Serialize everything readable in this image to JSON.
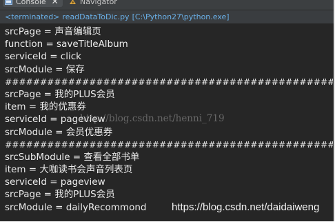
{
  "tabs": {
    "console_label": "Console",
    "navigator_label": "Navigator"
  },
  "status": {
    "state": "<terminated>",
    "script": "readDataToDic.py",
    "interpreter": "[C:\\Python27\\python.exe]"
  },
  "output_lines": [
    "srcPage = 声音编辑页",
    "function = saveTitleAlbum",
    "serviceId = click",
    "srcModule = 保存",
    "##################################################",
    "srcPage = 我的PLUS会员",
    "item = 我的优惠券",
    "serviceId = pageview",
    "srcModule = 会员优惠券",
    "##################################################",
    "srcSubModule = 查看全部书单",
    "item = 大咖读书会声音列表页",
    "serviceId = pageview",
    "srcPage = 我的PLUS会员",
    "srcModule = dailyRecommond"
  ],
  "watermarks": {
    "center": "http://blog.csdn.net/henni_719",
    "bottom": "https://blog.csdn.net/daidaiweng"
  },
  "colors": {
    "console_bg": "#262626",
    "status_text": "#6ab0e8",
    "output_text": "#ececec"
  }
}
